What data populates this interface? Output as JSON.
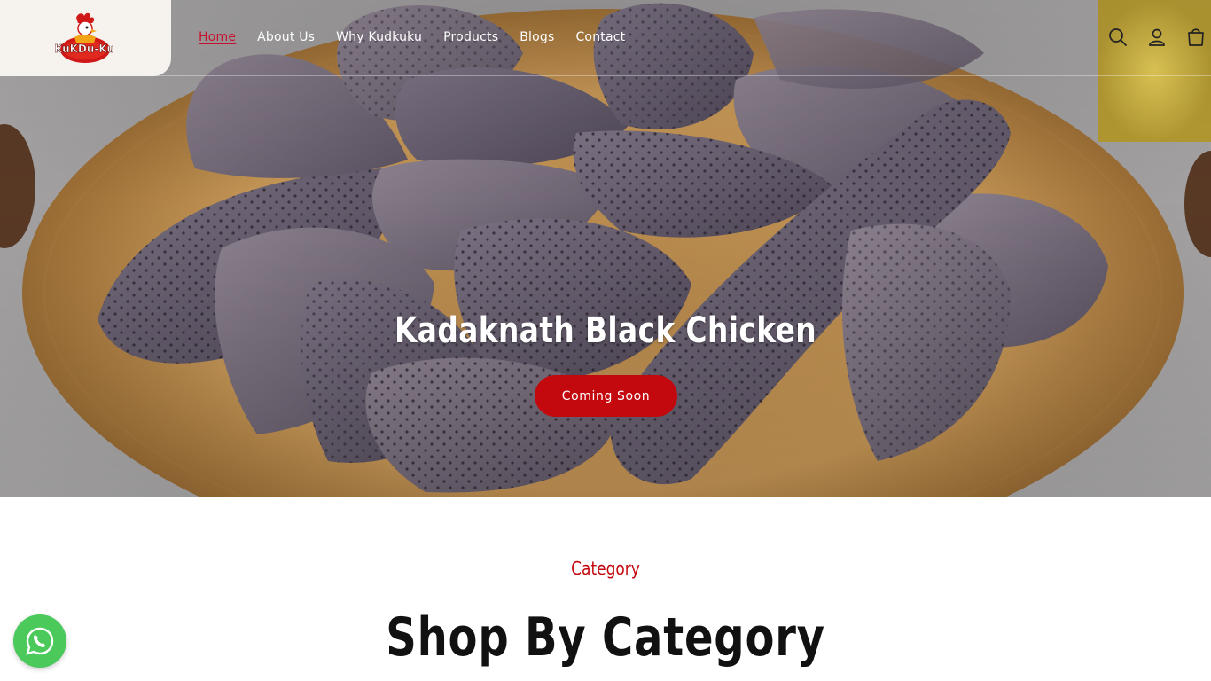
{
  "brand": {
    "logo_text": "KuKDu-Ku"
  },
  "nav": {
    "items": [
      {
        "label": "Home",
        "active": true
      },
      {
        "label": "About Us"
      },
      {
        "label": "Why Kudkuku"
      },
      {
        "label": "Products"
      },
      {
        "label": "Blogs"
      },
      {
        "label": "Contact"
      }
    ]
  },
  "header_icons": [
    "search-icon",
    "account-icon",
    "cart-icon"
  ],
  "hero": {
    "title": "Kadaknath Black Chicken",
    "cta_label": "Coming Soon"
  },
  "category_section": {
    "eyebrow": "Category",
    "title": "Shop By Category"
  },
  "colors": {
    "accent": "#c3080e",
    "whatsapp": "#4cc95b",
    "logo_bg": "#f6f3ee"
  }
}
